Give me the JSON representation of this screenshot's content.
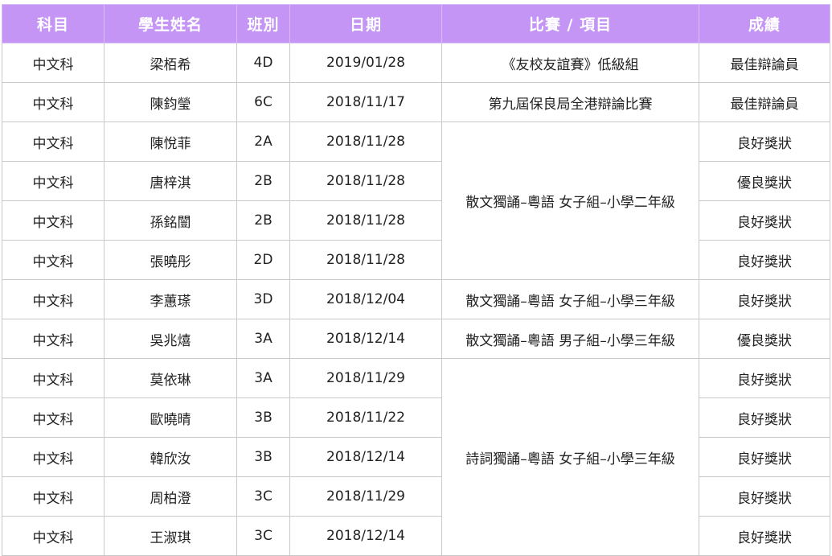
{
  "table": {
    "headers": [
      "科目",
      "學生姓名",
      "班別",
      "日期",
      "比賽 / 項目",
      "成績"
    ],
    "rows": [
      {
        "subject": "中文科",
        "name": "梁栢希",
        "class": "4D",
        "date": "2019/01/28",
        "event": "《友校友誼賽》低級組",
        "result": "最佳辯論員"
      },
      {
        "subject": "中文科",
        "name": "陳鈞瑩",
        "class": "6C",
        "date": "2018/11/17",
        "event": "第九屆保良局全港辯論比賽",
        "result": "最佳辯論員"
      },
      {
        "subject": "中文科",
        "name": "陳悅菲",
        "class": "2A",
        "date": "2018/11/28",
        "event": "散文獨誦–粵語  女子組–小學二年級",
        "result": "良好獎狀"
      },
      {
        "subject": "中文科",
        "name": "唐梓淇",
        "class": "2B",
        "date": "2018/11/28",
        "event": null,
        "result": "優良獎狀"
      },
      {
        "subject": "中文科",
        "name": "孫銘闓",
        "class": "2B",
        "date": "2018/11/28",
        "event": null,
        "result": "良好獎狀"
      },
      {
        "subject": "中文科",
        "name": "張曉彤",
        "class": "2D",
        "date": "2018/11/28",
        "event": null,
        "result": "良好獎狀"
      },
      {
        "subject": "中文科",
        "name": "李蕙瑹",
        "class": "3D",
        "date": "2018/12/04",
        "event": "散文獨誦–粵語  女子組–小學三年級",
        "result": "良好獎狀"
      },
      {
        "subject": "中文科",
        "name": "吳兆熺",
        "class": "3A",
        "date": "2018/12/14",
        "event": "散文獨誦–粵語  男子組–小學三年級",
        "result": "優良獎狀"
      },
      {
        "subject": "中文科",
        "name": "莫依琳",
        "class": "3A",
        "date": "2018/11/29",
        "event": "詩詞獨誦–粵語  女子組–小學三年級",
        "result": "良好獎狀"
      },
      {
        "subject": "中文科",
        "name": "歐曉晴",
        "class": "3B",
        "date": "2018/11/22",
        "event": null,
        "result": "良好獎狀"
      },
      {
        "subject": "中文科",
        "name": "韓欣汝",
        "class": "3B",
        "date": "2018/12/14",
        "event": null,
        "result": "良好獎狀"
      },
      {
        "subject": "中文科",
        "name": "周柏澄",
        "class": "3C",
        "date": "2018/11/29",
        "event": null,
        "result": "良好獎狀"
      },
      {
        "subject": "中文科",
        "name": "王淑琪",
        "class": "3C",
        "date": "2018/12/14",
        "event": null,
        "result": "良好獎狀"
      }
    ]
  }
}
